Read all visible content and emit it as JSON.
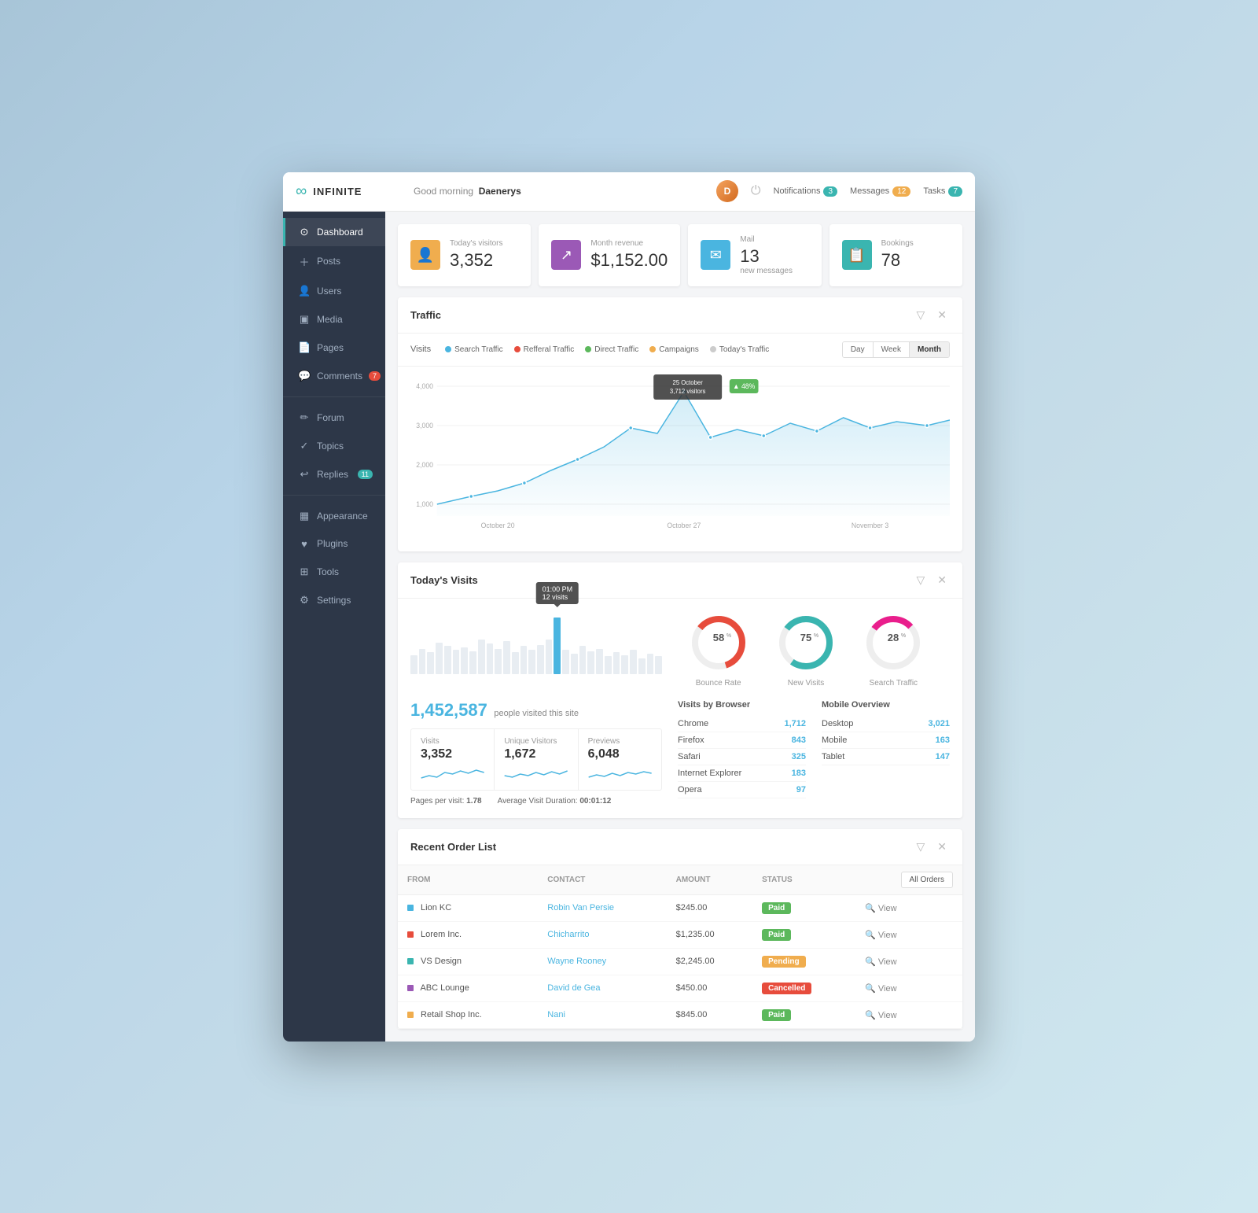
{
  "app": {
    "logo": "∞",
    "name": "INFINITE"
  },
  "topbar": {
    "greeting": "Good morning",
    "user": "Daenerys",
    "notifications_label": "Notifications",
    "notifications_count": "3",
    "messages_label": "Messages",
    "messages_count": "12",
    "tasks_label": "Tasks",
    "tasks_count": "7",
    "power_icon": "⏻"
  },
  "sidebar": {
    "items": [
      {
        "label": "Dashboard",
        "icon": "⊙",
        "active": true
      },
      {
        "label": "Posts",
        "icon": "+",
        "active": false
      },
      {
        "label": "Users",
        "icon": "👤",
        "active": false
      },
      {
        "label": "Media",
        "icon": "▣",
        "active": false
      },
      {
        "label": "Pages",
        "icon": "📄",
        "active": false
      },
      {
        "label": "Comments",
        "icon": "💬",
        "badge": "7",
        "active": false
      },
      {
        "label": "Forum",
        "icon": "✏",
        "active": false
      },
      {
        "label": "Topics",
        "icon": "✓",
        "active": false
      },
      {
        "label": "Replies",
        "icon": "↩",
        "badge": "11",
        "active": false
      },
      {
        "label": "Appearance",
        "icon": "▦",
        "active": false
      },
      {
        "label": "Plugins",
        "icon": "♥",
        "active": false
      },
      {
        "label": "Tools",
        "icon": "⊞",
        "active": false
      },
      {
        "label": "Settings",
        "icon": "⚙",
        "active": false
      }
    ]
  },
  "stats": [
    {
      "label": "Today's visitors",
      "value": "3,352",
      "icon": "👤",
      "color": "orange"
    },
    {
      "label": "Month revenue",
      "value": "$1,152.00",
      "icon": "↗",
      "color": "purple"
    },
    {
      "label": "Mail",
      "value": "13",
      "sub": "new messages",
      "icon": "✉",
      "color": "blue"
    },
    {
      "label": "Bookings",
      "value": "78",
      "icon": "📋",
      "color": "teal"
    }
  ],
  "traffic": {
    "title": "Traffic",
    "legend": [
      {
        "label": "Search Traffic",
        "color": "#4ab5e0"
      },
      {
        "label": "Refferal Traffic",
        "color": "#e74c3c"
      },
      {
        "label": "Direct Traffic",
        "color": "#5cb85c"
      },
      {
        "label": "Campaigns",
        "color": "#f0ad4e"
      },
      {
        "label": "Today's Traffic",
        "color": "#ccc"
      }
    ],
    "time_buttons": [
      "Day",
      "Week",
      "Month"
    ],
    "active_time": "Month",
    "tooltip": {
      "date": "25 October",
      "visitors": "3,712 visitors",
      "percent": "48%",
      "up": true
    },
    "x_labels": [
      "October 20",
      "October 27",
      "November 3"
    ],
    "y_labels": [
      "4,000",
      "3,000",
      "2,000",
      "1,000"
    ]
  },
  "todays_visits": {
    "title": "Today's Visits",
    "bar_tooltip": {
      "time": "01:00 PM",
      "visits": "12 visits"
    },
    "big_number": "1,452,587",
    "big_number_sub": "people visited this site",
    "stats": [
      {
        "label": "Visits",
        "value": "3,352"
      },
      {
        "label": "Unique Visitors",
        "value": "1,672"
      },
      {
        "label": "Previews",
        "value": "6,048"
      }
    ],
    "footer": [
      {
        "label": "Pages per visit:",
        "value": "1.78"
      },
      {
        "label": "Average Visit Duration:",
        "value": "00:01:12"
      }
    ],
    "donuts": [
      {
        "label": "Bounce Rate",
        "value": 58,
        "color": "#e74c3c",
        "bg": "#eee"
      },
      {
        "label": "New Visits",
        "value": 75,
        "color": "#3ab5b0",
        "bg": "#eee"
      },
      {
        "label": "Search Traffic",
        "value": 28,
        "color": "#e91e8c",
        "bg": "#eee"
      }
    ],
    "browsers": {
      "title": "Visits by Browser",
      "rows": [
        {
          "name": "Chrome",
          "value": "1,712"
        },
        {
          "name": "Firefox",
          "value": "843"
        },
        {
          "name": "Safari",
          "value": "325"
        },
        {
          "name": "Internet Explorer",
          "value": "183"
        },
        {
          "name": "Opera",
          "value": "97"
        }
      ]
    },
    "mobile": {
      "title": "Mobile Overview",
      "rows": [
        {
          "name": "Desktop",
          "value": "3,021"
        },
        {
          "name": "Mobile",
          "value": "163"
        },
        {
          "name": "Tablet",
          "value": "147"
        }
      ]
    }
  },
  "orders": {
    "title": "Recent Order List",
    "btn_label": "All Orders",
    "columns": [
      "From",
      "Contact",
      "Amount",
      "Status"
    ],
    "rows": [
      {
        "from": "Lion KC",
        "dot_color": "#4ab5e0",
        "contact": "Robin Van Persie",
        "amount": "$245.00",
        "status": "Paid",
        "status_type": "paid"
      },
      {
        "from": "Lorem Inc.",
        "dot_color": "#e74c3c",
        "contact": "Chicharrito",
        "amount": "$1,235.00",
        "status": "Paid",
        "status_type": "paid"
      },
      {
        "from": "VS Design",
        "dot_color": "#3ab5b0",
        "contact": "Wayne Rooney",
        "amount": "$2,245.00",
        "status": "Pending",
        "status_type": "pending"
      },
      {
        "from": "ABC Lounge",
        "dot_color": "#9b59b6",
        "contact": "David de Gea",
        "amount": "$450.00",
        "status": "Cancelled",
        "status_type": "cancelled"
      },
      {
        "from": "Retail Shop Inc.",
        "dot_color": "#f0ad4e",
        "contact": "Nani",
        "amount": "$845.00",
        "status": "Paid",
        "status_type": "paid"
      }
    ],
    "view_label": "View"
  }
}
